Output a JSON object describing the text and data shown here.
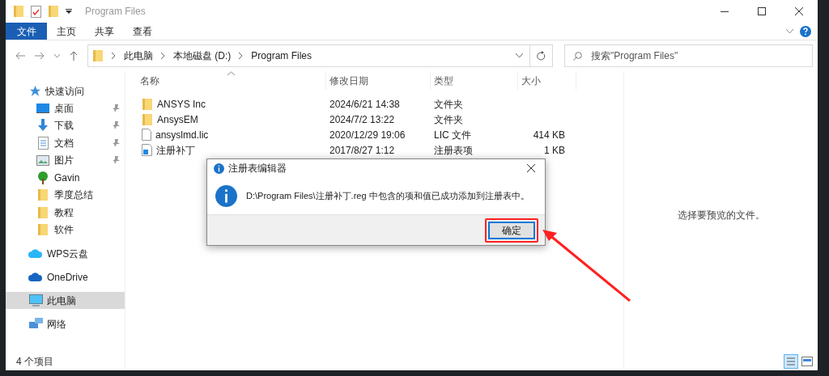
{
  "window": {
    "title": "Program Files"
  },
  "ribbon_tabs": [
    {
      "label": "文件",
      "selected": true
    },
    {
      "label": "主页",
      "selected": false
    },
    {
      "label": "共享",
      "selected": false
    },
    {
      "label": "查看",
      "selected": false
    }
  ],
  "breadcrumb": [
    "此电脑",
    "本地磁盘 (D:)",
    "Program Files"
  ],
  "search": {
    "placeholder": "搜索\"Program Files\""
  },
  "sidebar": {
    "items": [
      {
        "label": "快速访问",
        "kind": "quick",
        "selected": false,
        "children": [
          {
            "label": "桌面",
            "kind": "desktop",
            "pinned": true
          },
          {
            "label": "下载",
            "kind": "download",
            "pinned": true
          },
          {
            "label": "文档",
            "kind": "document",
            "pinned": true
          },
          {
            "label": "图片",
            "kind": "image",
            "pinned": true
          },
          {
            "label": "Gavin",
            "kind": "user",
            "pinned": false
          },
          {
            "label": "季度总结",
            "kind": "folder",
            "pinned": false
          },
          {
            "label": "教程",
            "kind": "folder",
            "pinned": false
          },
          {
            "label": "软件",
            "kind": "folder",
            "pinned": false
          }
        ]
      },
      {
        "label": "WPS云盘",
        "kind": "wps",
        "selected": false
      },
      {
        "label": "OneDrive",
        "kind": "onedrive",
        "selected": false
      },
      {
        "label": "此电脑",
        "kind": "pc",
        "selected": true
      },
      {
        "label": "网络",
        "kind": "network",
        "selected": false
      }
    ]
  },
  "table": {
    "columns": [
      "名称",
      "修改日期",
      "类型",
      "大小"
    ],
    "rows": [
      {
        "kind": "folder",
        "name": "ANSYS Inc",
        "date": "2024/6/21 14:38",
        "type": "文件夹",
        "size": ""
      },
      {
        "kind": "folder",
        "name": "AnsysEM",
        "date": "2024/7/2 13:22",
        "type": "文件夹",
        "size": ""
      },
      {
        "kind": "file",
        "name": "ansyslmd.lic",
        "date": "2020/12/29 19:06",
        "type": "LIC 文件",
        "size": "414 KB"
      },
      {
        "kind": "reg",
        "name": "注册补丁",
        "date": "2017/8/27 1:12",
        "type": "注册表项",
        "size": "1 KB"
      }
    ]
  },
  "preview": {
    "message": "选择要预览的文件。"
  },
  "status_bar": {
    "count": "4 个项目"
  },
  "dialog": {
    "title": "注册表编辑器",
    "message": "D:\\Program Files\\注册补丁.reg 中包含的项和值已成功添加到注册表中。",
    "button": "确定",
    "highlighted": true
  }
}
